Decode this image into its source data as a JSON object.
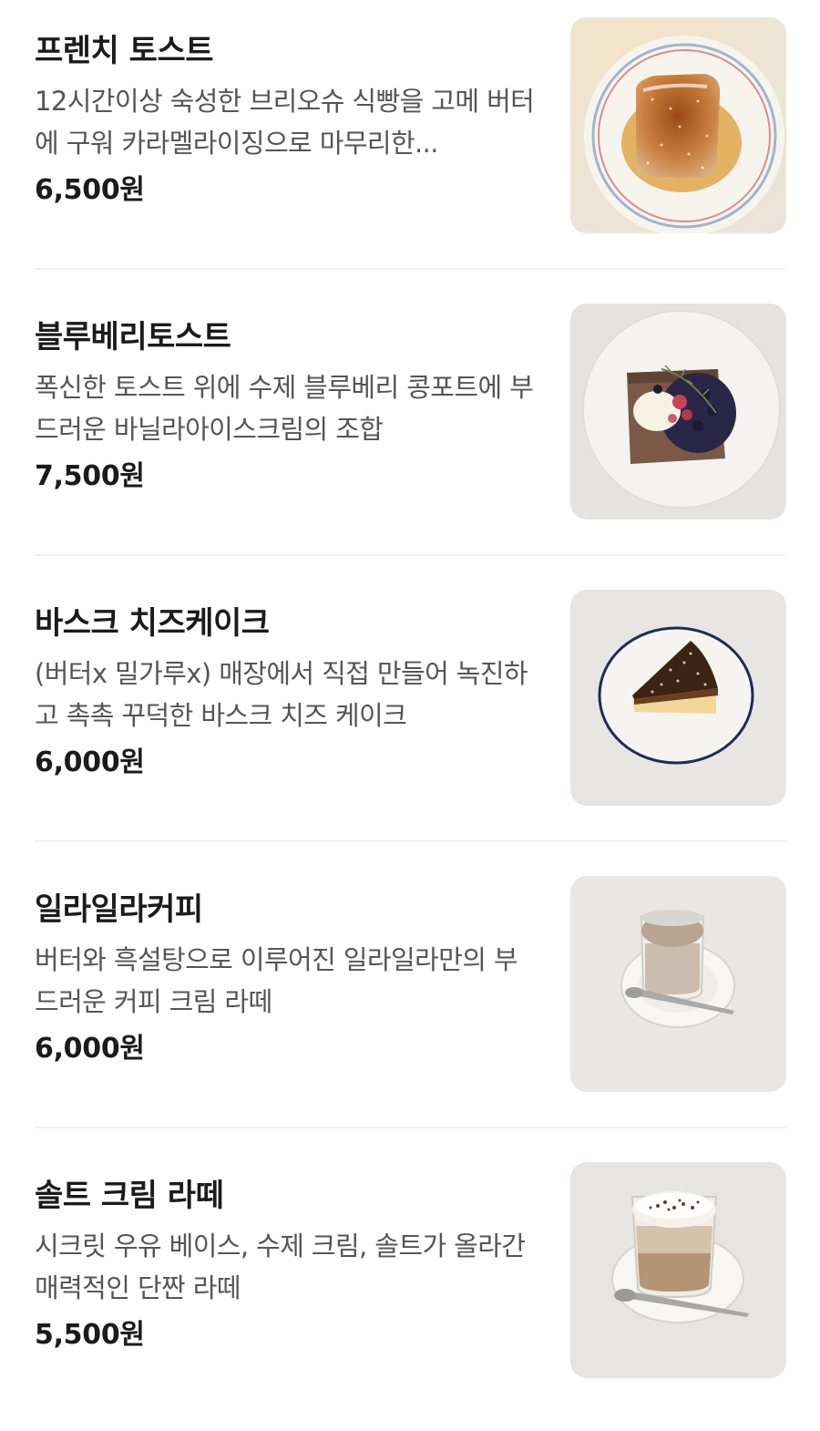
{
  "menu": {
    "items": [
      {
        "name": "프렌치 토스트",
        "description": "12시간이상 숙성한 브리오슈 식빵을 고메 버터에 구워 카라멜라이징으로 마무리한...",
        "price": "6,500원"
      },
      {
        "name": "블루베리토스트",
        "description": "폭신한 토스트 위에 수제 블루베리 콩포트에 부드러운 바닐라아이스크림의 조합",
        "price": "7,500원"
      },
      {
        "name": "바스크 치즈케이크",
        "description": "(버터x 밀가루x) 매장에서 직접 만들어 녹진하고 촉촉 꾸덕한 바스크 치즈 케이크",
        "price": "6,000원"
      },
      {
        "name": "일라일라커피",
        "description": "버터와 흑설탕으로 이루어진 일라일라만의 부드러운 커피 크림 라떼",
        "price": "6,000원"
      },
      {
        "name": "솔트 크림 라떼",
        "description": "시크릿 우유 베이스, 수제 크림, 솔트가 올라간 매력적인 단짠 라떼",
        "price": "5,500원"
      }
    ]
  }
}
